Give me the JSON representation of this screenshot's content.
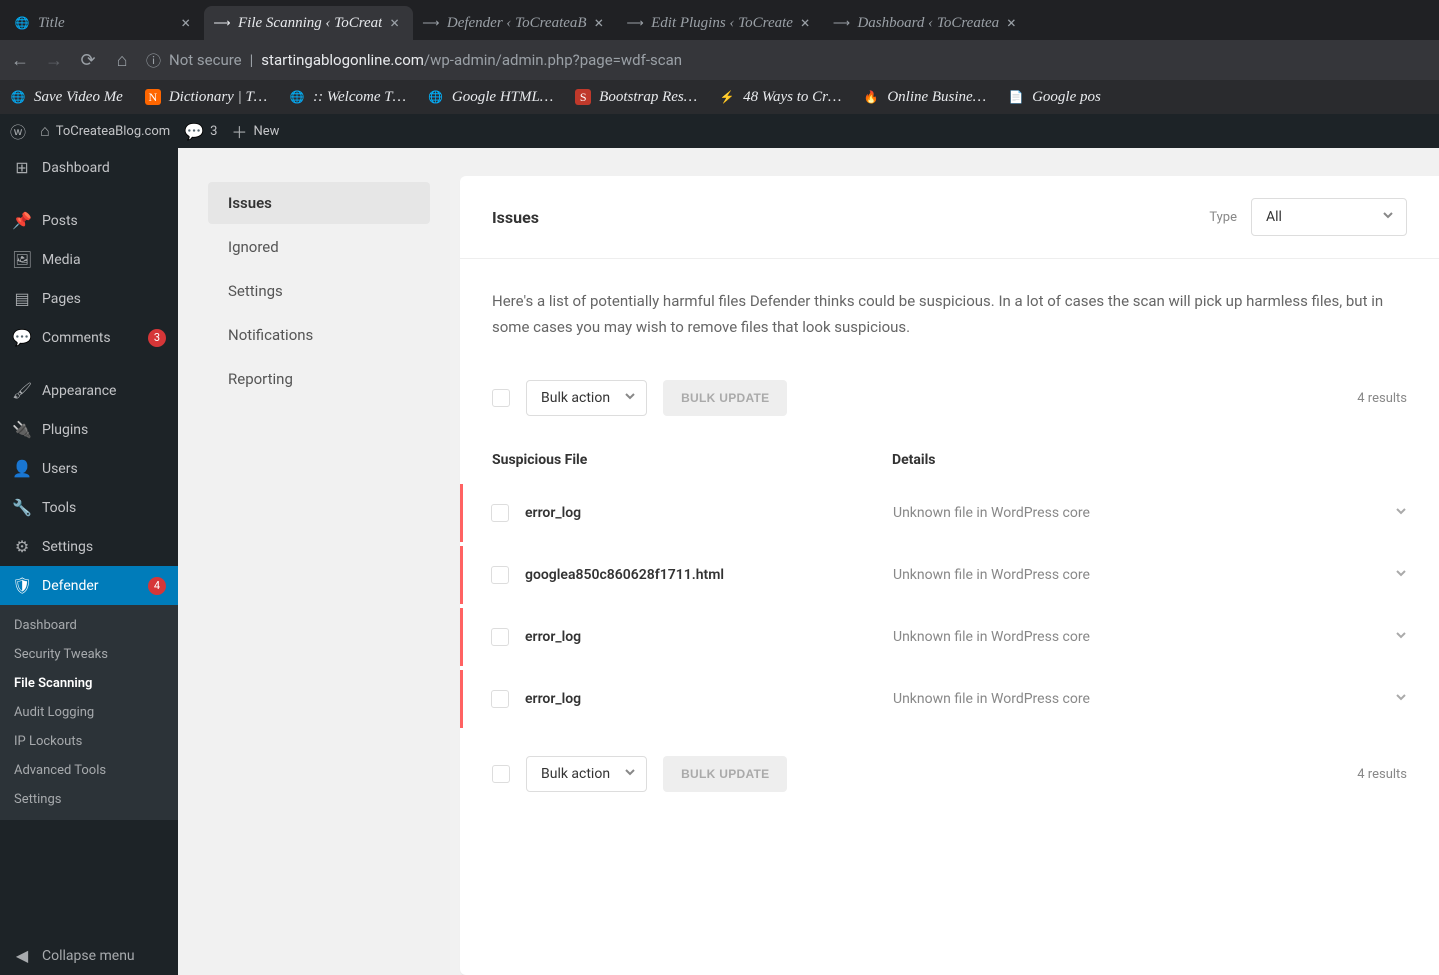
{
  "tabs": [
    {
      "title": "Title",
      "active": false
    },
    {
      "title": "File Scanning ‹ ToCreat",
      "active": true
    },
    {
      "title": "Defender ‹ ToCreateaB",
      "active": false
    },
    {
      "title": "Edit Plugins ‹ ToCreate",
      "active": false
    },
    {
      "title": "Dashboard ‹ ToCreatea",
      "active": false
    }
  ],
  "url": {
    "not_secure": "Not secure",
    "host": "startingablogonline.com",
    "path": "/wp-admin/admin.php?page=wdf-scan"
  },
  "bookmarks": [
    "Save Video Me",
    "Dictionary | T…",
    ":: Welcome T…",
    "Google HTML…",
    "Bootstrap Res…",
    "48 Ways to Cr…",
    "Online Busine…",
    "Google pos"
  ],
  "wpbar": {
    "site": "ToCreateaBlog.com",
    "comments": "3",
    "new": "New"
  },
  "sidebar": {
    "items": [
      {
        "icon": "dashboard",
        "label": "Dashboard"
      },
      {
        "icon": "posts",
        "label": "Posts"
      },
      {
        "icon": "media",
        "label": "Media"
      },
      {
        "icon": "pages",
        "label": "Pages"
      },
      {
        "icon": "comments",
        "label": "Comments",
        "badge": "3"
      },
      {
        "icon": "appearance",
        "label": "Appearance"
      },
      {
        "icon": "plugins",
        "label": "Plugins"
      },
      {
        "icon": "users",
        "label": "Users"
      },
      {
        "icon": "tools",
        "label": "Tools"
      },
      {
        "icon": "settings",
        "label": "Settings"
      },
      {
        "icon": "defender",
        "label": "Defender",
        "badge": "4",
        "active": true
      }
    ],
    "submenu": [
      "Dashboard",
      "Security Tweaks",
      "File Scanning",
      "Audit Logging",
      "IP Lockouts",
      "Advanced Tools",
      "Settings"
    ],
    "submenu_current_index": 2,
    "collapse": "Collapse menu"
  },
  "vtabs": [
    "Issues",
    "Ignored",
    "Settings",
    "Notifications",
    "Reporting"
  ],
  "panel": {
    "title": "Issues",
    "type_label": "Type",
    "type_value": "All",
    "description": "Here's a list of potentially harmful files Defender thinks could be suspicious. In a lot of cases the scan will pick up harmless files, but in some cases you may wish to  remove files that look suspicious.",
    "bulk_action": "Bulk action",
    "bulk_update": "BULK UPDATE",
    "results": "4 results",
    "col_file": "Suspicious File",
    "col_details": "Details",
    "rows": [
      {
        "file": "error_log",
        "detail": "Unknown file in WordPress core"
      },
      {
        "file": "googlea850c860628f1711.html",
        "detail": "Unknown file in WordPress core"
      },
      {
        "file": "error_log",
        "detail": "Unknown file in WordPress core"
      },
      {
        "file": "error_log",
        "detail": "Unknown file in WordPress core"
      }
    ]
  }
}
